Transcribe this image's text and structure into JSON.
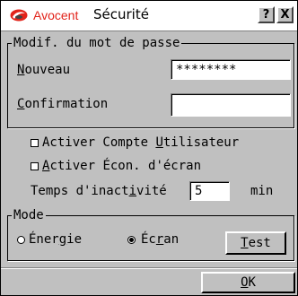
{
  "window": {
    "brand": "Avocent",
    "title": "Sécurité",
    "help_label": "?",
    "close_label": "X"
  },
  "password_group": {
    "legend": "Modif. du mot de passe",
    "new_label_key": "N",
    "new_label_rest": "ouveau",
    "new_value": "********",
    "confirm_label_key": "C",
    "confirm_label_rest": "onfirmation",
    "confirm_value": ""
  },
  "options": {
    "enable_user_account_pre": "Activer Compte ",
    "enable_user_account_key": "U",
    "enable_user_account_post": "tilisateur",
    "enable_user_account_checked": false,
    "enable_screensaver_key": "A",
    "enable_screensaver_post": "ctiver Écon. d'écran",
    "enable_screensaver_checked": false,
    "inactivity_pre": "Temps d'inact",
    "inactivity_key": "i",
    "inactivity_post": "vité",
    "inactivity_value": "5",
    "inactivity_unit": "min"
  },
  "mode_group": {
    "legend": "Mode",
    "energy_pre": "Éner",
    "energy_key": "g",
    "energy_post": "ie",
    "energy_selected": false,
    "screen_pre": "Éc",
    "screen_key": "r",
    "screen_post": "an",
    "screen_selected": true,
    "test_key": "T",
    "test_rest": "est"
  },
  "footer": {
    "ok_key": "O",
    "ok_rest": "K"
  }
}
